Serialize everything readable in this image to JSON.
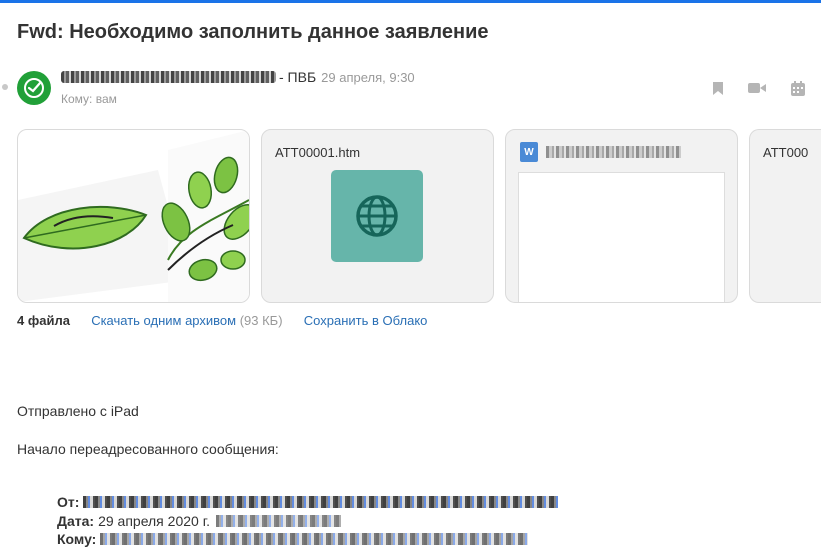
{
  "email": {
    "subject": "Fwd: Необходимо заполнить данное заявление",
    "sender_org": "- ПВБ",
    "date": "29 апреля, 9:30",
    "recipient": "Кому: вам"
  },
  "header_icons": [
    "bookmark-icon",
    "video-icon",
    "calendar-icon"
  ],
  "attachments": [
    {
      "name": "",
      "kind": "image"
    },
    {
      "name": "ATT00001.htm",
      "kind": "html"
    },
    {
      "name": "",
      "kind": "word"
    },
    {
      "name": "ATT000",
      "kind": "file"
    }
  ],
  "files_bar": {
    "count": "4 файла",
    "download_label": "Скачать одним архивом",
    "download_size": "(93 КБ)",
    "cloud_label": "Сохранить в Облако"
  },
  "body": {
    "line1": "Отправлено с iPad",
    "line2": "Начало переадресованного сообщения:",
    "from_label": "От:",
    "date_label": "Дата:",
    "date_value": "29 апреля 2020 г.",
    "to_label": "Кому:"
  },
  "colors": {
    "accent": "#1a73e8",
    "link": "#2a6fb5",
    "avatar": "#21a038",
    "globe_tile": "#66b5aa"
  }
}
